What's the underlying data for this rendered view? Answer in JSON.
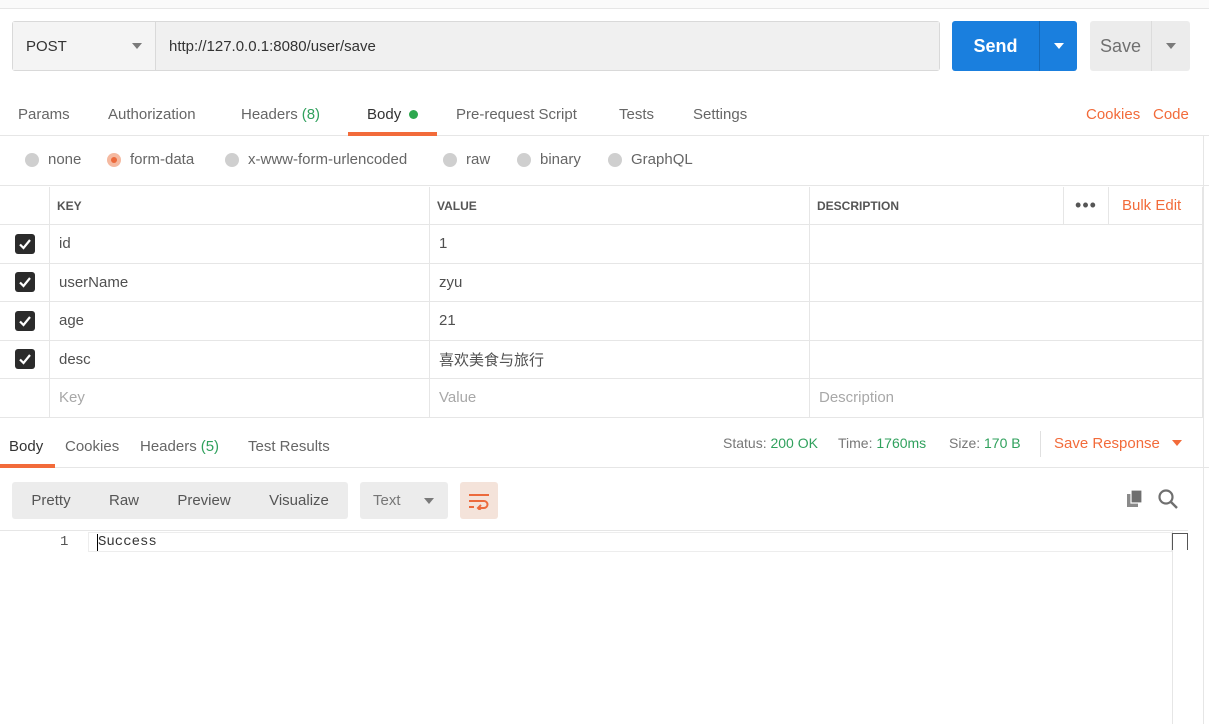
{
  "request": {
    "method": "POST",
    "url": "http://127.0.0.1:8080/user/save",
    "send_label": "Send",
    "save_label": "Save"
  },
  "request_tabs": {
    "params": "Params",
    "authorization": "Authorization",
    "headers": "Headers",
    "headers_count": "(8)",
    "body": "Body",
    "pre_request": "Pre-request Script",
    "tests": "Tests",
    "settings": "Settings",
    "cookies": "Cookies",
    "code": "Code"
  },
  "body_types": {
    "none": "none",
    "form_data": "form-data",
    "urlencoded": "x-www-form-urlencoded",
    "raw": "raw",
    "binary": "binary",
    "graphql": "GraphQL",
    "selected": "form-data"
  },
  "params_table": {
    "headers": {
      "key": "KEY",
      "value": "VALUE",
      "description": "DESCRIPTION",
      "bulk_edit": "Bulk Edit"
    },
    "rows": [
      {
        "checked": true,
        "key": "id",
        "value": "1",
        "description": ""
      },
      {
        "checked": true,
        "key": "userName",
        "value": "zyu",
        "description": ""
      },
      {
        "checked": true,
        "key": "age",
        "value": "21",
        "description": ""
      },
      {
        "checked": true,
        "key": "desc",
        "value": "喜欢美食与旅行",
        "description": ""
      }
    ],
    "placeholders": {
      "key": "Key",
      "value": "Value",
      "description": "Description"
    }
  },
  "response_tabs": {
    "body": "Body",
    "cookies": "Cookies",
    "headers": "Headers",
    "headers_count": "(5)",
    "test_results": "Test Results"
  },
  "response_status": {
    "status_label": "Status:",
    "status_value": "200 OK",
    "time_label": "Time:",
    "time_value": "1760ms",
    "size_label": "Size:",
    "size_value": "170 B",
    "save_response": "Save Response"
  },
  "response_toolbar": {
    "pretty": "Pretty",
    "raw": "Raw",
    "preview": "Preview",
    "visualize": "Visualize",
    "format": "Text"
  },
  "response_body": {
    "line_number": "1",
    "content": "Success"
  },
  "colors": {
    "accent": "#f26b3a",
    "send_blue": "#1a7fde",
    "success_green": "#30a15d"
  }
}
